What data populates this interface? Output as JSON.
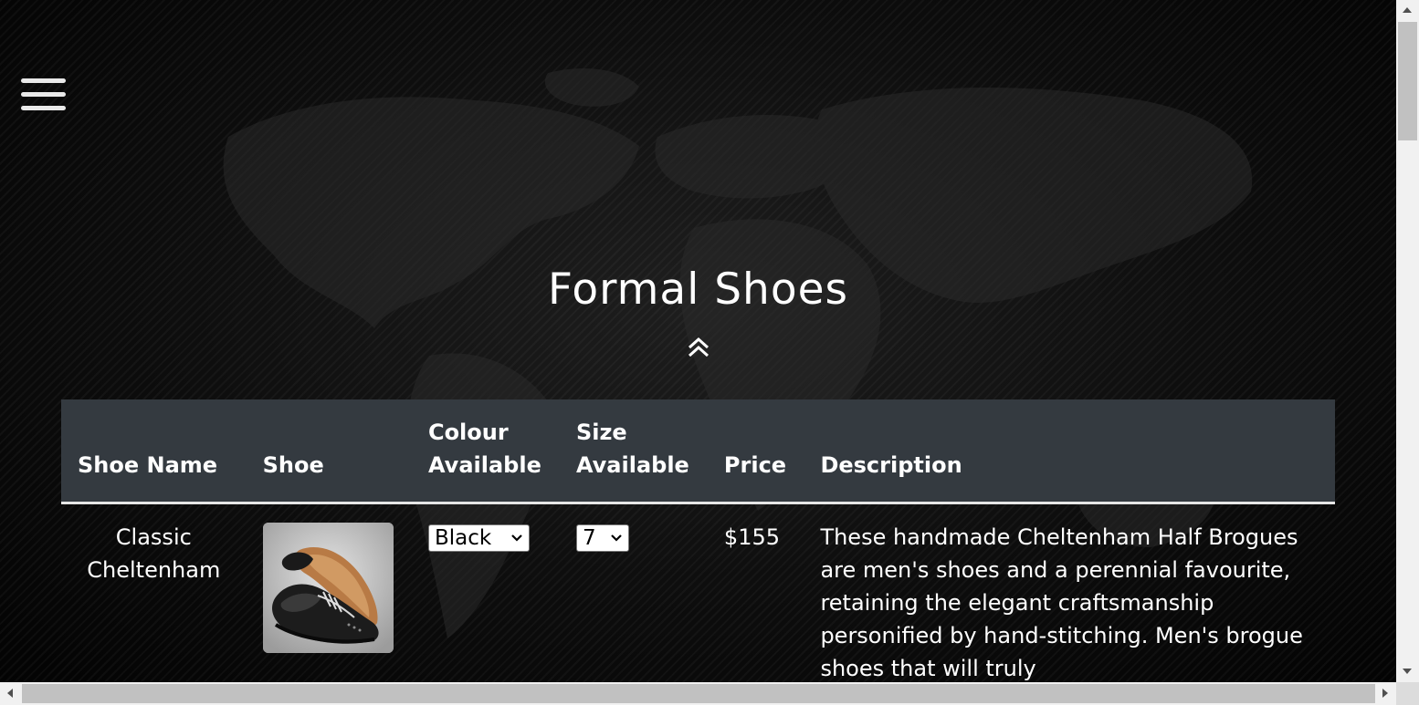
{
  "page": {
    "title": "Formal Shoes"
  },
  "icons": {
    "menu": "hamburger-menu-icon",
    "scroll_up": "double-chevron-up-icon",
    "select_arrow": "chevron-down-icon"
  },
  "colors": {
    "background": "#000000",
    "table_header_bg": "#343a40",
    "text": "#ffffff",
    "header_divider": "#e6e6e6"
  },
  "table": {
    "headers": {
      "name": "Shoe Name",
      "shoe": "Shoe",
      "colour": "Colour Available",
      "size": "Size Available",
      "price": "Price",
      "description": "Description"
    },
    "rows": [
      {
        "name": "Classic Cheltenham",
        "image_alt": "black-brogue-shoe-image",
        "colour_selected": "Black",
        "size_selected": "7",
        "price": "$155",
        "description": "These handmade Cheltenham Half Brogues are men's shoes and a perennial favourite, retaining the elegant craftsmanship personified by hand-stitching. Men's brogue shoes that will truly"
      }
    ]
  }
}
